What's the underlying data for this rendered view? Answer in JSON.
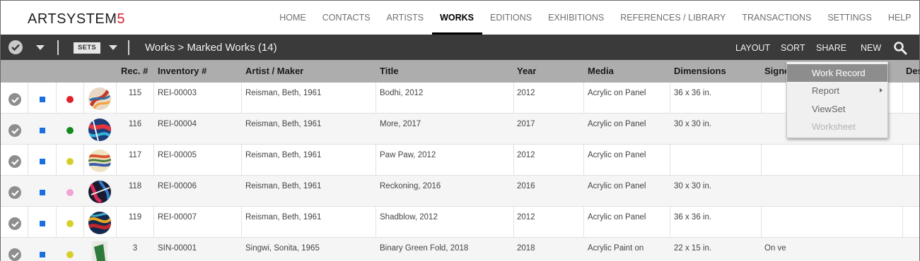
{
  "app": {
    "logo_text": "ARTSYSTEM",
    "logo_suffix": "5"
  },
  "nav": {
    "items": [
      {
        "label": "HOME",
        "active": false
      },
      {
        "label": "CONTACTS",
        "active": false
      },
      {
        "label": "ARTISTS",
        "active": false
      },
      {
        "label": "WORKS",
        "active": true
      },
      {
        "label": "EDITIONS",
        "active": false
      },
      {
        "label": "EXHIBITIONS",
        "active": false
      },
      {
        "label": "REFERENCES / LIBRARY",
        "active": false
      },
      {
        "label": "TRANSACTIONS",
        "active": false
      },
      {
        "label": "SETTINGS",
        "active": false
      },
      {
        "label": "HELP",
        "active": false
      }
    ]
  },
  "toolbar": {
    "sets_label": "SETS",
    "breadcrumb": "Works > Marked Works (14)",
    "layout_label": "LAYOUT",
    "sort_label": "SORT",
    "share_label": "SHARE",
    "new_label": "NEW"
  },
  "table": {
    "headers": {
      "rec": "Rec. #",
      "inventory": "Inventory #",
      "artist": "Artist / Maker",
      "title": "Title",
      "year": "Year",
      "media": "Media",
      "dimensions": "Dimensions",
      "signed": "Signed",
      "desc": "Des"
    },
    "rows": [
      {
        "rec": "115",
        "inventory": "REI-00003",
        "artist": "Reisman, Beth, 1961",
        "title": "Bodhi, 2012",
        "year": "2012",
        "media": "Acrylic on Panel",
        "dimensions": "36 x 36 in.",
        "signed": "",
        "dot_color": "#e0202a"
      },
      {
        "rec": "116",
        "inventory": "REI-00004",
        "artist": "Reisman, Beth, 1961",
        "title": "More, 2017",
        "year": "2017",
        "media": "Acrylic on Panel",
        "dimensions": "30 x 30 in.",
        "signed": "",
        "dot_color": "#138a1c"
      },
      {
        "rec": "117",
        "inventory": "REI-00005",
        "artist": "Reisman, Beth, 1961",
        "title": "Paw Paw, 2012",
        "year": "2012",
        "media": "Acrylic on Panel",
        "dimensions": "",
        "signed": "",
        "dot_color": "#d6cf2a"
      },
      {
        "rec": "118",
        "inventory": "REI-00006",
        "artist": "Reisman, Beth, 1961",
        "title": "Reckoning, 2016",
        "year": "2016",
        "media": "Acrylic on Panel",
        "dimensions": "30 x 30 in.",
        "signed": "",
        "dot_color": "#f0a3d4"
      },
      {
        "rec": "119",
        "inventory": "REI-00007",
        "artist": "Reisman, Beth, 1961",
        "title": "Shadblow, 2012",
        "year": "2012",
        "media": "Acrylic on Panel",
        "dimensions": "36 x 36 in.",
        "signed": "",
        "dot_color": "#d6cf2a"
      },
      {
        "rec": "3",
        "inventory": "SIN-00001",
        "artist": "Singwi, Sonita, 1965",
        "title": "Binary Green Fold, 2018",
        "year": "2018",
        "media": "Acrylic Paint on",
        "dimensions": "22 x 15 in.",
        "signed": "On verso",
        "dot_color": "#d6cf2a"
      }
    ]
  },
  "menu": {
    "items": [
      {
        "label": "Work Record",
        "state": "highlighted"
      },
      {
        "label": "Report",
        "state": "submenu"
      },
      {
        "label": "ViewSet",
        "state": "normal"
      },
      {
        "label": "Worksheet",
        "state": "disabled"
      }
    ]
  },
  "colors": {
    "accent": "#d4202a",
    "toolbar": "#3a3a3a",
    "header": "#adadad",
    "marker": "#1a6fe0"
  }
}
